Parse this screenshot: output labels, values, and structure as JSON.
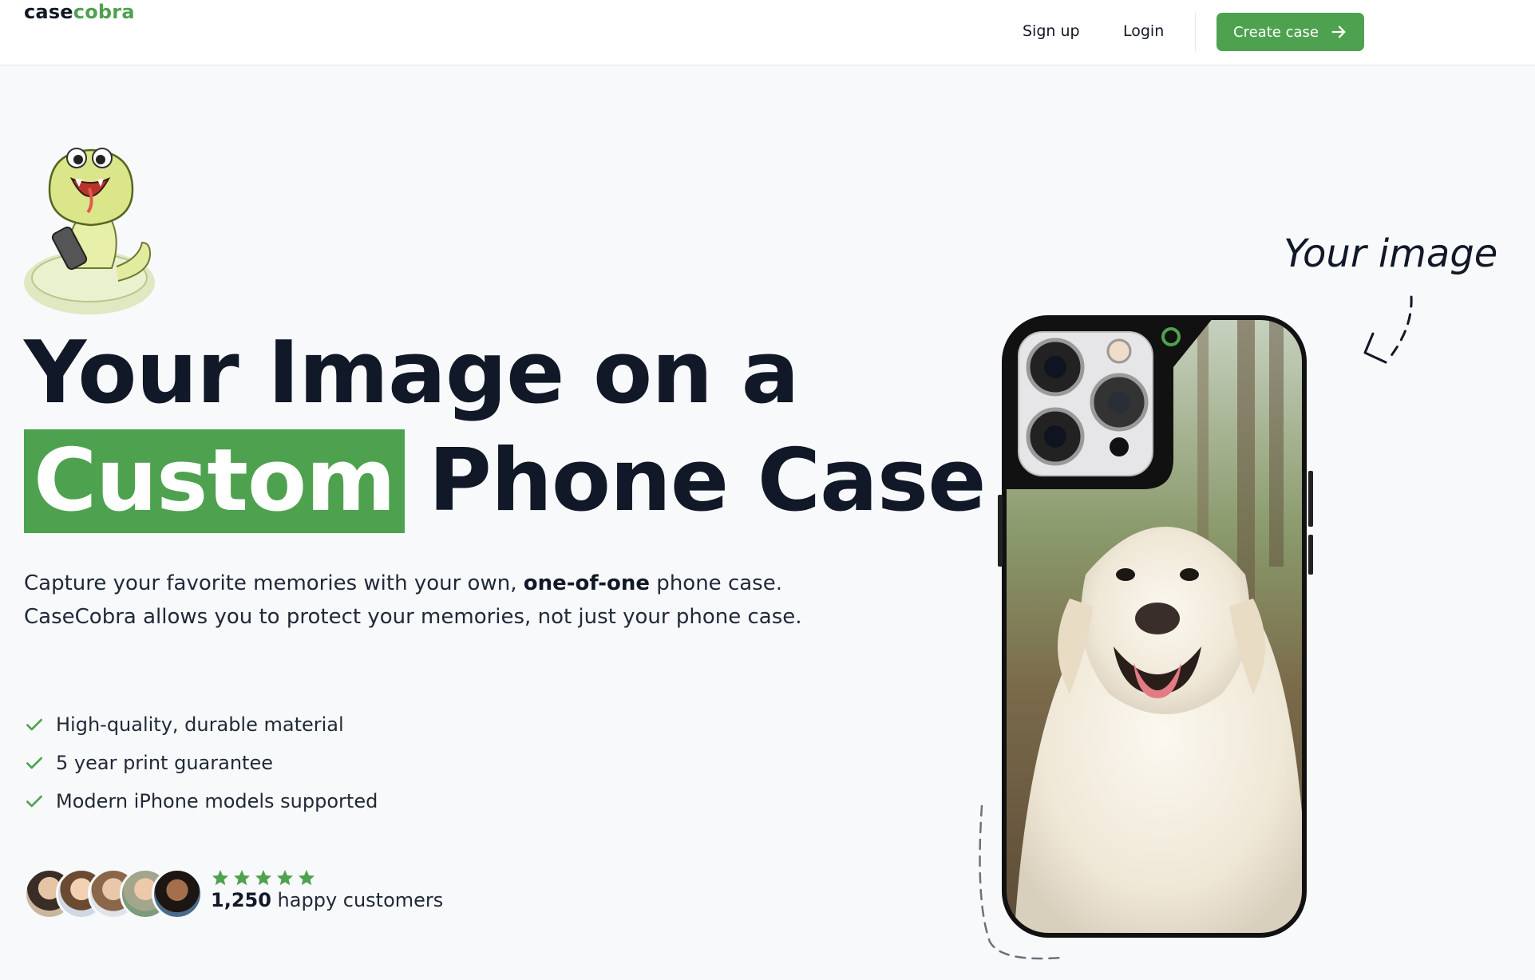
{
  "nav": {
    "logo_part1": "case",
    "logo_part2": "cobra",
    "signup": "Sign up",
    "login": "Login",
    "cta_label": "Create case"
  },
  "hero": {
    "headline_line1": "Your Image on a",
    "headline_highlight": "Custom",
    "headline_rest": "Phone Case",
    "desc_part1": "Capture your favorite memories with your own, ",
    "desc_bold": "one-of-one",
    "desc_part2": " phone case. CaseCobra allows you to protect your memories, not just your phone case.",
    "features": [
      "High-quality, durable material",
      "5 year print guarantee",
      "Modern iPhone models supported"
    ],
    "rating_stars": 5,
    "customers_count": "1,250",
    "customers_text": " happy customers",
    "annotation": "Your image"
  },
  "colors": {
    "accent": "#4ea24f",
    "text": "#111827",
    "background": "#f8f9fb"
  },
  "icons": [
    "arrow-right-icon",
    "check-icon",
    "star-icon",
    "snake-mascot",
    "dog-photo"
  ]
}
